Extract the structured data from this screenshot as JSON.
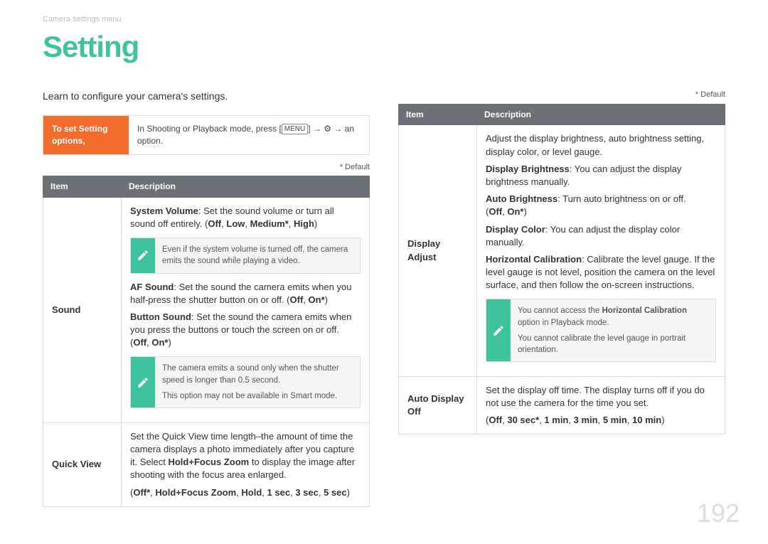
{
  "breadcrumb": "Camera settings menu",
  "title": "Setting",
  "intro": "Learn to configure your camera's settings.",
  "instruct": {
    "left": "To set Setting options,",
    "right_prefix": "In Shooting or Playback mode, press [",
    "menu_label": "MENU",
    "right_mid": "] → ",
    "right_suffix": " → an option."
  },
  "default_note": "* Default",
  "table_headers": {
    "item": "Item",
    "desc": "Description"
  },
  "left_rows": {
    "sound": {
      "item": "Sound",
      "p1a": "System Volume",
      "p1b": ": Set the sound volume or turn all sound off entirely. (",
      "p1c": "Off",
      "p1d": ", ",
      "p1e": "Low",
      "p1f": ", ",
      "p1g": "Medium*",
      "p1h": ", ",
      "p1i": "High",
      "p1j": ")",
      "note1": "Even if the system volume is turned off, the camera emits the sound while playing a video.",
      "p2a": "AF Sound",
      "p2b": ": Set the sound the camera emits when you half-press the shutter button on or off. (",
      "p2c": "Off",
      "p2d": ", ",
      "p2e": "On*",
      "p2f": ")",
      "p3a": "Button Sound",
      "p3b": ": Set the sound the camera emits when you press the buttons or touch the screen on or off.",
      "p3c": "(",
      "p3d": "Off",
      "p3e": ", ",
      "p3f": "On*",
      "p3g": ")",
      "note2a": "The camera emits a sound only when the shutter speed is longer than 0.5 second.",
      "note2b": "This option may not be available in Smart mode."
    },
    "quick": {
      "item": "Quick View",
      "p1": "Set the Quick View time length–the amount of time the camera displays a photo immediately after you capture it. Select ",
      "p1b": "Hold+Focus Zoom",
      "p1c": " to display the image after shooting with the focus area enlarged.",
      "p2a": "(",
      "p2b": "Off*",
      "p2c": ", ",
      "p2d": "Hold+Focus Zoom",
      "p2e": ", ",
      "p2f": "Hold",
      "p2g": ", ",
      "p2h": "1 sec",
      "p2i": ", ",
      "p2j": "3 sec",
      "p2k": ", ",
      "p2l": "5 sec",
      "p2m": ")"
    }
  },
  "right_rows": {
    "display": {
      "item": "Display Adjust",
      "p1": "Adjust the display brightness, auto brightness setting, display color, or level gauge.",
      "p2a": "Display Brightness",
      "p2b": ": You can adjust the display brightness manually.",
      "p3a": "Auto Brightness",
      "p3b": ": Turn auto brightness on or off.",
      "p3c": "(",
      "p3d": "Off",
      "p3e": ", ",
      "p3f": "On*",
      "p3g": ")",
      "p4a": "Display Color",
      "p4b": ": You can adjust the display color manually.",
      "p5a": "Horizontal Calibration",
      "p5b": ": Calibrate the level gauge. If the level gauge is not level, position the camera on the level surface, and then follow the on-screen instructions.",
      "note_a1": "You cannot access the ",
      "note_a1b": "Horizontal Calibration",
      "note_a1c": " option in Playback mode.",
      "note_a2": "You cannot calibrate the level gauge in portrait orientation."
    },
    "auto": {
      "item": "Auto Display Off",
      "p1": "Set the display off time. The display turns off if you do not use the camera for the time you set.",
      "p2a": "(",
      "p2b": "Off",
      "p2c": ", ",
      "p2d": "30 sec*",
      "p2e": ", ",
      "p2f": "1 min",
      "p2g": ", ",
      "p2h": "3 min",
      "p2i": ", ",
      "p2j": "5 min",
      "p2k": ", ",
      "p2l": "10 min",
      "p2m": ")"
    }
  },
  "page_number": "192"
}
